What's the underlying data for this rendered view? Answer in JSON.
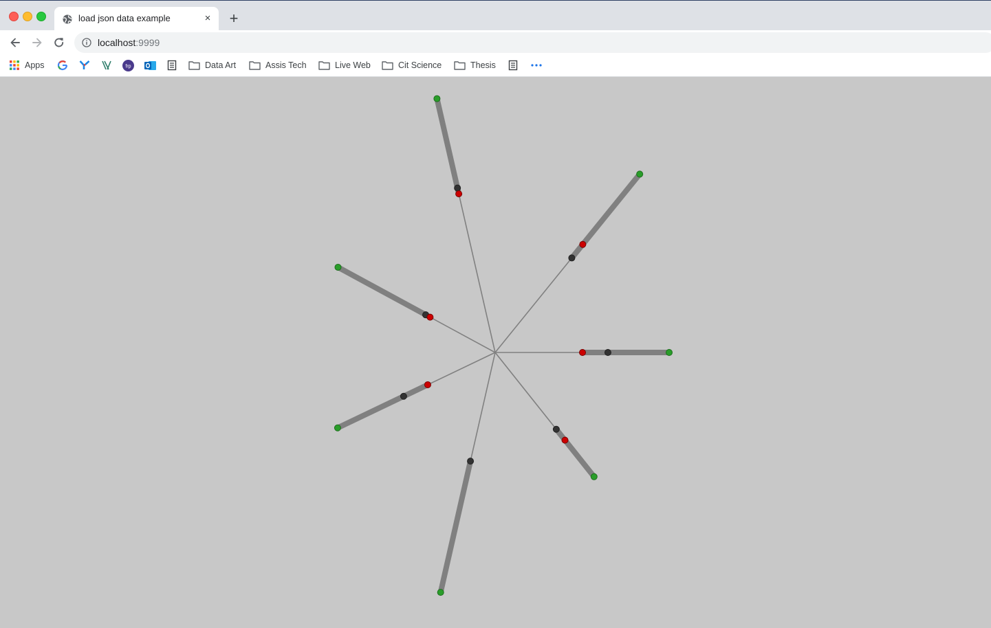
{
  "browser": {
    "tab_title": "load json data example",
    "tab_close": "×",
    "new_tab": "+",
    "url_host": "localhost",
    "url_port": ":9999"
  },
  "bookmarks": [
    {
      "label": "Apps",
      "icon": "apps-grid-icon"
    },
    {
      "label": "",
      "icon": "google-icon"
    },
    {
      "label": "",
      "icon": "yahoo-y-icon"
    },
    {
      "label": "",
      "icon": "x-logo-icon"
    },
    {
      "label": "",
      "icon": "purple-circle-icon"
    },
    {
      "label": "",
      "icon": "outlook-icon"
    },
    {
      "label": "",
      "icon": "page-icon"
    },
    {
      "label": "Data Art",
      "icon": "folder-icon"
    },
    {
      "label": "Assis Tech",
      "icon": "folder-icon"
    },
    {
      "label": "Live Web",
      "icon": "folder-icon"
    },
    {
      "label": "Cit Science",
      "icon": "folder-icon"
    },
    {
      "label": "Thesis",
      "icon": "folder-icon"
    },
    {
      "label": "",
      "icon": "page-icon"
    },
    {
      "label": "",
      "icon": "more-icon"
    }
  ],
  "canvas": {
    "background": "#c8c8c8",
    "spoke_color": "#808080",
    "marker_colors": {
      "green": "#2a9d2a",
      "red": "#cc0000",
      "dark": "#333333"
    },
    "spokes": [
      {
        "angle_deg": -102.9,
        "green": 1.0,
        "dark": 0.648,
        "red": 0.625
      },
      {
        "angle_deg": -51.0,
        "green": 1.0,
        "dark": 0.53,
        "red": 0.606
      },
      {
        "angle_deg": -151.5,
        "green": 1.0,
        "dark": 0.442,
        "red": 0.414
      },
      {
        "angle_deg": 0.0,
        "green": 1.0,
        "dark": 0.648,
        "red": 0.502
      },
      {
        "angle_deg": 154.4,
        "green": 1.0,
        "dark": 0.581,
        "red": 0.428
      },
      {
        "angle_deg": 51.5,
        "green": 1.0,
        "dark": 0.618,
        "red": 0.706
      },
      {
        "angle_deg": 102.8,
        "green": 1.0,
        "dark": 0.453,
        "red": null
      }
    ]
  }
}
